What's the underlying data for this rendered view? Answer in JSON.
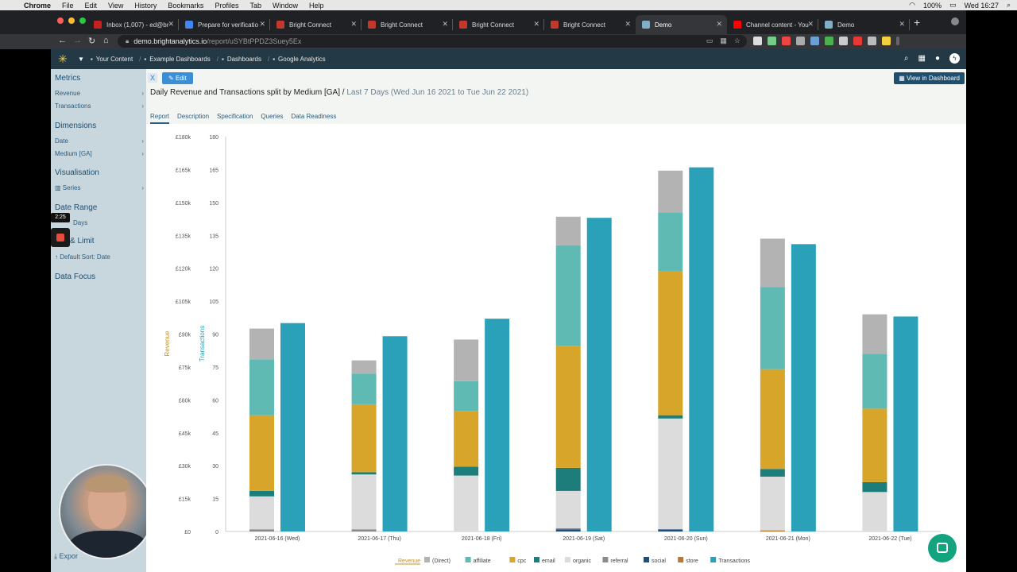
{
  "menubar": {
    "app": "Chrome",
    "items": [
      "File",
      "Edit",
      "View",
      "History",
      "Bookmarks",
      "Profiles",
      "Tab",
      "Window",
      "Help"
    ],
    "battery": "100%",
    "clock": "Wed 16:27"
  },
  "tabs": [
    {
      "label": "Inbox (1,007) - ed@br",
      "color": "#c5221f"
    },
    {
      "label": "Prepare for verificatio",
      "color": "#4285f4"
    },
    {
      "label": "Bright Connect",
      "color": "#c0392b"
    },
    {
      "label": "Bright Connect",
      "color": "#c0392b"
    },
    {
      "label": "Bright Connect",
      "color": "#c0392b"
    },
    {
      "label": "Bright Connect",
      "color": "#c0392b"
    },
    {
      "label": "Demo",
      "color": "#7fb0c9"
    },
    {
      "label": "Channel content - You",
      "color": "#ff0000"
    },
    {
      "label": "Demo",
      "color": "#7fb0c9"
    }
  ],
  "address": {
    "host": "demo.brightanalytics.io",
    "path": "/report/uSYBtPPDZ3Suey5Ex"
  },
  "breadcrumbs": [
    "Your Content",
    "Example Dashboards",
    "Dashboards",
    "Google Analytics"
  ],
  "sidebar": {
    "metrics_heading": "Metrics",
    "metrics": [
      "Revenue",
      "Transactions"
    ],
    "dimensions_heading": "Dimensions",
    "dimensions": [
      "Date",
      "Medium [GA]"
    ],
    "vis_heading": "Visualisation",
    "vis_item": "Series",
    "daterange_heading": "Date Range",
    "daterange_item": "Days",
    "limit_heading": "& Limit",
    "sort_item": "Default Sort: Date",
    "focus_heading": "Data Focus",
    "exports": "Expor"
  },
  "recording": {
    "timer": "2:25"
  },
  "report": {
    "close": "X",
    "edit": "Edit",
    "view_dashboard": "View in Dashboard",
    "title": "Daily Revenue and Transactions split by Medium [GA] /",
    "range": "Last 7 Days (Wed Jun 16 2021 to Tue Jun 22 2021)",
    "tabs": [
      "Report",
      "Description",
      "Specification",
      "Queries",
      "Data Readiness"
    ]
  },
  "chart_data": {
    "type": "bar",
    "categories": [
      "2021-06-16 (Wed)",
      "2021-06-17 (Thu)",
      "2021-06-18 (Fri)",
      "2021-06-19 (Sat)",
      "2021-06-20 (Sun)",
      "2021-06-21 (Mon)",
      "2021-06-22 (Tue)"
    ],
    "y_left": {
      "label": "Revenue",
      "ticks": [
        "£0",
        "£15k",
        "£30k",
        "£45k",
        "£60k",
        "£75k",
        "£90k",
        "£105k",
        "£120k",
        "£135k",
        "£150k",
        "£165k",
        "£180k"
      ],
      "range": [
        0,
        180000
      ]
    },
    "y_right": {
      "label": "Transactions",
      "ticks": [
        "0",
        "15",
        "30",
        "45",
        "60",
        "75",
        "90",
        "105",
        "120",
        "135",
        "150",
        "165",
        "180"
      ],
      "range": [
        0,
        180
      ]
    },
    "revenue_series": [
      {
        "name": "(Direct)",
        "color": "#b3b3b3",
        "values": [
          14000,
          6000,
          19000,
          13000,
          19000,
          22000,
          18000
        ]
      },
      {
        "name": "affiliate",
        "color": "#5ebab3",
        "values": [
          25500,
          14000,
          13500,
          46000,
          27000,
          37500,
          25000
        ]
      },
      {
        "name": "cpc",
        "color": "#d6a52a",
        "values": [
          34500,
          31000,
          25500,
          55500,
          65500,
          45500,
          33500
        ]
      },
      {
        "name": "email",
        "color": "#1d7d7a",
        "values": [
          2500,
          1000,
          4000,
          10500,
          1500,
          3500,
          4500
        ]
      },
      {
        "name": "organic",
        "color": "#dcdcdc",
        "values": [
          15000,
          25000,
          25500,
          17000,
          50500,
          24500,
          18000
        ]
      },
      {
        "name": "referral",
        "color": "#8c8c8c",
        "values": [
          1000,
          1000,
          0,
          500,
          0,
          0,
          0
        ]
      },
      {
        "name": "social",
        "color": "#1f4e79",
        "values": [
          0,
          0,
          0,
          1000,
          1000,
          0,
          0
        ]
      },
      {
        "name": "store",
        "color": "#b87a2b",
        "values": [
          0,
          0,
          0,
          0,
          0,
          500,
          0
        ]
      }
    ],
    "transactions_series": {
      "name": "Transactions",
      "color": "#2aa0b9",
      "values": [
        95,
        89,
        97,
        143,
        166,
        131,
        98
      ]
    },
    "legend_title": "Revenue",
    "legend": "bottom-center"
  }
}
